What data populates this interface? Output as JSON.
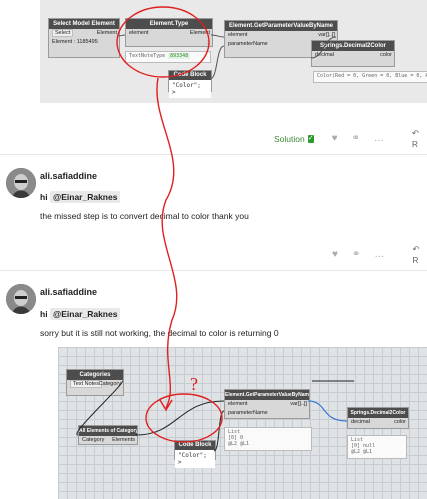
{
  "top_graph": {
    "select_model_element": {
      "title": "Select Model Element",
      "select_label": "Select",
      "output_port": "Element",
      "status": "Element : 1185495"
    },
    "element_type": {
      "title": "Element.Type",
      "input_port": "element",
      "output_port": "Element",
      "preview_label": "TextNoteType",
      "preview_value": "893348"
    },
    "get_param": {
      "title": "Element.GetParameterValueByName",
      "input_1": "element",
      "input_2": "parameterName",
      "output_port": "var[]..[]"
    },
    "springs": {
      "title": "Springs.Decimal2Color",
      "input_port": "decimal",
      "output_port": "color",
      "preview": "Color(Red = 0, Green = 0, Blue = 0, Alpha"
    },
    "code_block": {
      "title": "Code Block",
      "code": "\"Color\";",
      "output_port": ">"
    },
    "lacing_mark": "1"
  },
  "post1_actions": {
    "solution_label": "Solution",
    "check_glyph": "✓",
    "heart": "♥",
    "link": "⚭",
    "more": "…",
    "reply": "R"
  },
  "post2": {
    "username": "ali.safiaddine",
    "greeting": "hi",
    "mention": "@Einar_Raknes",
    "body": "the missed step is to convert decimal to color thank you",
    "actions": {
      "heart": "♥",
      "link": "⚭",
      "more": "…",
      "reply": "R"
    }
  },
  "post3": {
    "username": "ali.safiaddine",
    "greeting": "hi",
    "mention": "@Einar_Raknes",
    "body": "sorry but it is still not working, the decimal to color is returning 0"
  },
  "bottom_graph": {
    "categories": {
      "title": "Categories",
      "value": "Text Notes",
      "output_port": "Category"
    },
    "all_elements": {
      "title": "All Elements of Category",
      "input_port": "Category",
      "output_port": "Elements"
    },
    "get_param": {
      "title": "Element.GetParameterValueByName",
      "input_1": "element",
      "input_2": "parameterName",
      "output_port": "var[]..[]"
    },
    "springs": {
      "title": "Springs.Decimal2Color",
      "input_port": "decimal",
      "output_port": "color"
    },
    "code_block": {
      "title": "Code Block",
      "code": "\"Color\";",
      "output_port": ">"
    },
    "preview_1_list": "List",
    "preview_1_item": "[0] 0",
    "preview_2_list": "List",
    "preview_2_item": "[0] null",
    "preview_footer": "@L2 @L1",
    "annotation": "?"
  }
}
